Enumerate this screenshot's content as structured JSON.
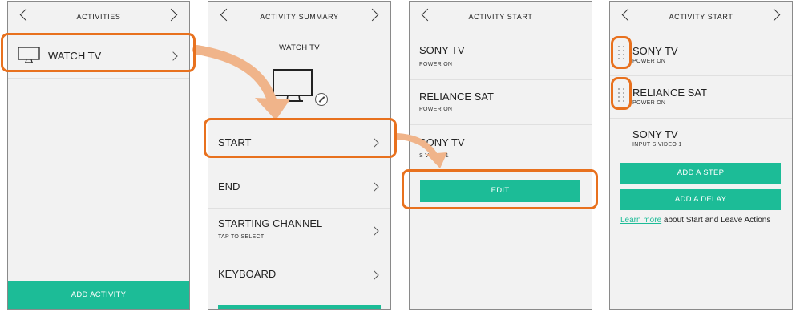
{
  "colors": {
    "accent": "#1cbc97",
    "callout": "#e8711e",
    "arrow": "#f0b48a"
  },
  "screen1": {
    "title": "ACTIVITIES",
    "items": [
      {
        "label": "WATCH TV",
        "icon": "tv-icon"
      }
    ],
    "add_button": "ADD ACTIVITY"
  },
  "screen2": {
    "title": "ACTIVITY SUMMARY",
    "activity_name": "WATCH TV",
    "rows": [
      {
        "label": "START",
        "sub": ""
      },
      {
        "label": "END",
        "sub": ""
      },
      {
        "label": "STARTING CHANNEL",
        "sub": "TAP TO SELECT"
      },
      {
        "label": "KEYBOARD",
        "sub": ""
      }
    ]
  },
  "screen3": {
    "title": "ACTIVITY START",
    "steps": [
      {
        "device": "SONY TV",
        "action": "POWER ON"
      },
      {
        "device": "RELIANCE SAT",
        "action": "POWER ON"
      },
      {
        "device": "SONY TV",
        "action": "S VIDEO 1"
      }
    ],
    "edit_button": "EDIT"
  },
  "screen4": {
    "title": "ACTIVITY START",
    "steps": [
      {
        "device": "SONY TV",
        "action": "POWER ON"
      },
      {
        "device": "RELIANCE SAT",
        "action": "POWER ON"
      },
      {
        "device": "SONY TV",
        "action": "INPUT S VIDEO 1"
      }
    ],
    "add_step_button": "ADD A STEP",
    "add_delay_button": "ADD A DELAY",
    "learn_more_link": "Learn more",
    "learn_more_text": " about Start and Leave Actions"
  }
}
